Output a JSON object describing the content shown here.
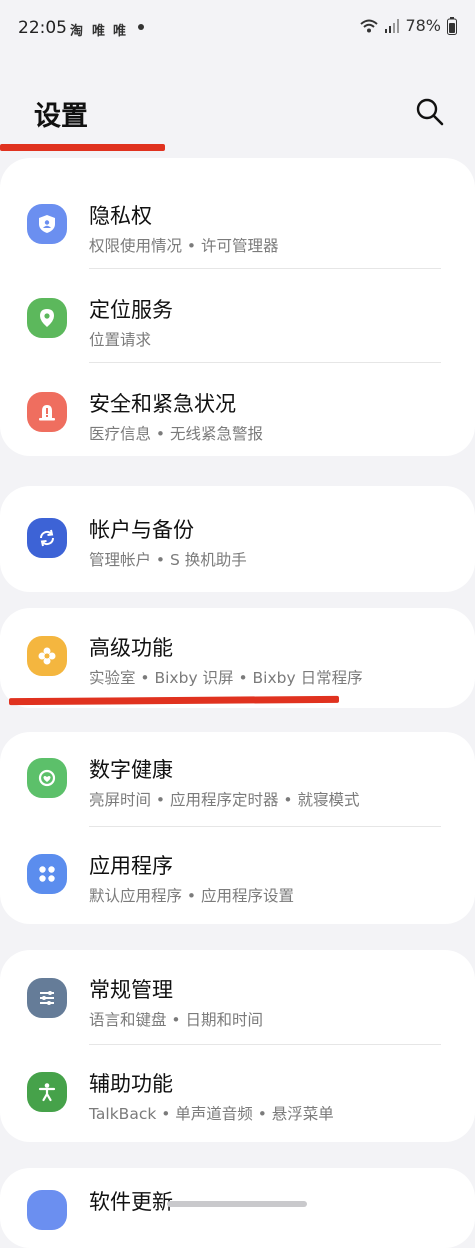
{
  "status_bar": {
    "time": "22:05",
    "app_icons": [
      "淘",
      "唯",
      "唯"
    ],
    "battery": "78%",
    "icons": [
      "wifi-icon",
      "signal-icon",
      "battery-icon"
    ]
  },
  "header": {
    "title": "设置",
    "search_icon": "search-icon"
  },
  "colors": {
    "annotation": "#e0321f"
  },
  "groups": [
    {
      "items": [
        {
          "title": "隐私权",
          "subtitle": "权限使用情况 • 许可管理器",
          "icon": "privacy-shield-icon",
          "color": "#6b8ff0"
        },
        {
          "title": "定位服务",
          "subtitle": "位置请求",
          "icon": "location-pin-icon",
          "color": "#5cb85c"
        },
        {
          "title": "安全和紧急状况",
          "subtitle": "医疗信息 • 无线紧急警报",
          "icon": "emergency-icon",
          "color": "#ef6e5f"
        }
      ]
    },
    {
      "items": [
        {
          "title": "帐户与备份",
          "subtitle": "管理帐户 • S 换机助手",
          "icon": "sync-icon",
          "color": "#3d63d6"
        }
      ]
    },
    {
      "items": [
        {
          "title": "高级功能",
          "subtitle": "实验室 • Bixby 识屏 • Bixby 日常程序",
          "icon": "advanced-features-icon",
          "color": "#f4b63f"
        }
      ]
    },
    {
      "items": [
        {
          "title": "数字健康",
          "subtitle": "亮屏时间 • 应用程序定时器 • 就寝模式",
          "icon": "digital-wellbeing-icon",
          "color": "#5cc06a"
        },
        {
          "title": "应用程序",
          "subtitle": "默认应用程序 • 应用程序设置",
          "icon": "apps-grid-icon",
          "color": "#5b8dee"
        }
      ]
    },
    {
      "items": [
        {
          "title": "常规管理",
          "subtitle": "语言和键盘 • 日期和时间",
          "icon": "sliders-icon",
          "color": "#657c98"
        },
        {
          "title": "辅助功能",
          "subtitle": "TalkBack • 单声道音频 • 悬浮菜单",
          "icon": "accessibility-icon",
          "color": "#46a24a"
        }
      ]
    }
  ],
  "partial_item": {
    "title": "软件更新"
  }
}
